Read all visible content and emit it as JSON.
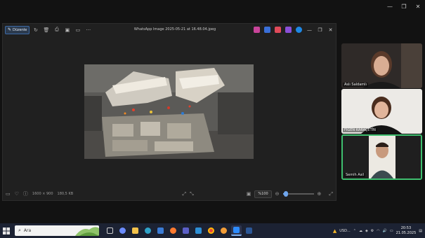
{
  "meeting_window": {
    "controls": [
      "minimize-icon",
      "maximize-icon",
      "close-icon"
    ]
  },
  "viewer": {
    "edit_label": "Düzenle",
    "file_title": "WhatsApp Image 2025-05-21 at 16.48.04.jpeg",
    "dimensions": "1600 × 900",
    "file_size": "180,5 KB",
    "zoom": "%100",
    "zoom_level": 0.1,
    "accent": "#6fa6ee"
  },
  "participants": [
    {
      "name": "Aslı Saldamlı"
    },
    {
      "name": "FİGEN KARAÇETİN"
    },
    {
      "name": "Semih Asil",
      "active": true
    }
  ],
  "taskbar": {
    "search_placeholder": "Ara",
    "tray_currency": "USD...",
    "time": "20:53",
    "date": "21.05.2025"
  }
}
